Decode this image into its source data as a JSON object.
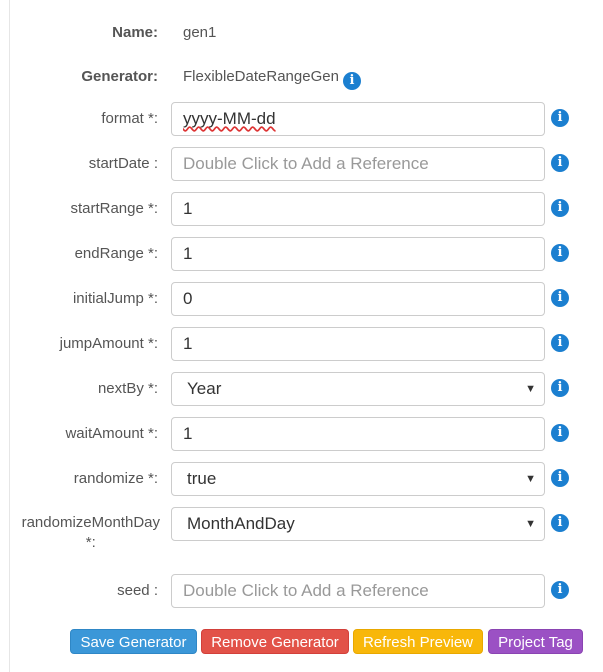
{
  "form": {
    "name": {
      "label": "Name:",
      "value": "gen1"
    },
    "generator": {
      "label": "Generator:",
      "value": "FlexibleDateRangeGen"
    },
    "fields": [
      {
        "label": "format *:",
        "type": "input",
        "value": "yyyy-MM-dd",
        "placeholder": ""
      },
      {
        "label": "startDate :",
        "type": "input",
        "value": "",
        "placeholder": "Double Click to Add a Reference"
      },
      {
        "label": "startRange *:",
        "type": "input",
        "value": "1",
        "placeholder": ""
      },
      {
        "label": "endRange *:",
        "type": "input",
        "value": "1",
        "placeholder": ""
      },
      {
        "label": "initialJump *:",
        "type": "input",
        "value": "0",
        "placeholder": ""
      },
      {
        "label": "jumpAmount *:",
        "type": "input",
        "value": "1",
        "placeholder": ""
      },
      {
        "label": "nextBy *:",
        "type": "select",
        "value": "Year"
      },
      {
        "label": "waitAmount *:",
        "type": "input",
        "value": "1",
        "placeholder": ""
      },
      {
        "label": "randomize *:",
        "type": "select",
        "value": "true"
      },
      {
        "label_line1": "randomizeMonthDay",
        "label_line2": "*:",
        "type": "select",
        "value": "MonthAndDay"
      },
      {
        "label": "seed :",
        "type": "input",
        "value": "",
        "placeholder": "Double Click to Add a Reference"
      }
    ],
    "info_glyph": "i",
    "caret_glyph": "▼"
  },
  "buttons": {
    "save": "Save Generator",
    "remove": "Remove Generator",
    "refresh": "Refresh Preview",
    "tag": "Project Tag"
  },
  "colors": {
    "info": "#1b7fd0",
    "save": "#3b97d8",
    "remove": "#e25248",
    "refresh": "#f8b70a",
    "tag": "#9b51c4"
  }
}
